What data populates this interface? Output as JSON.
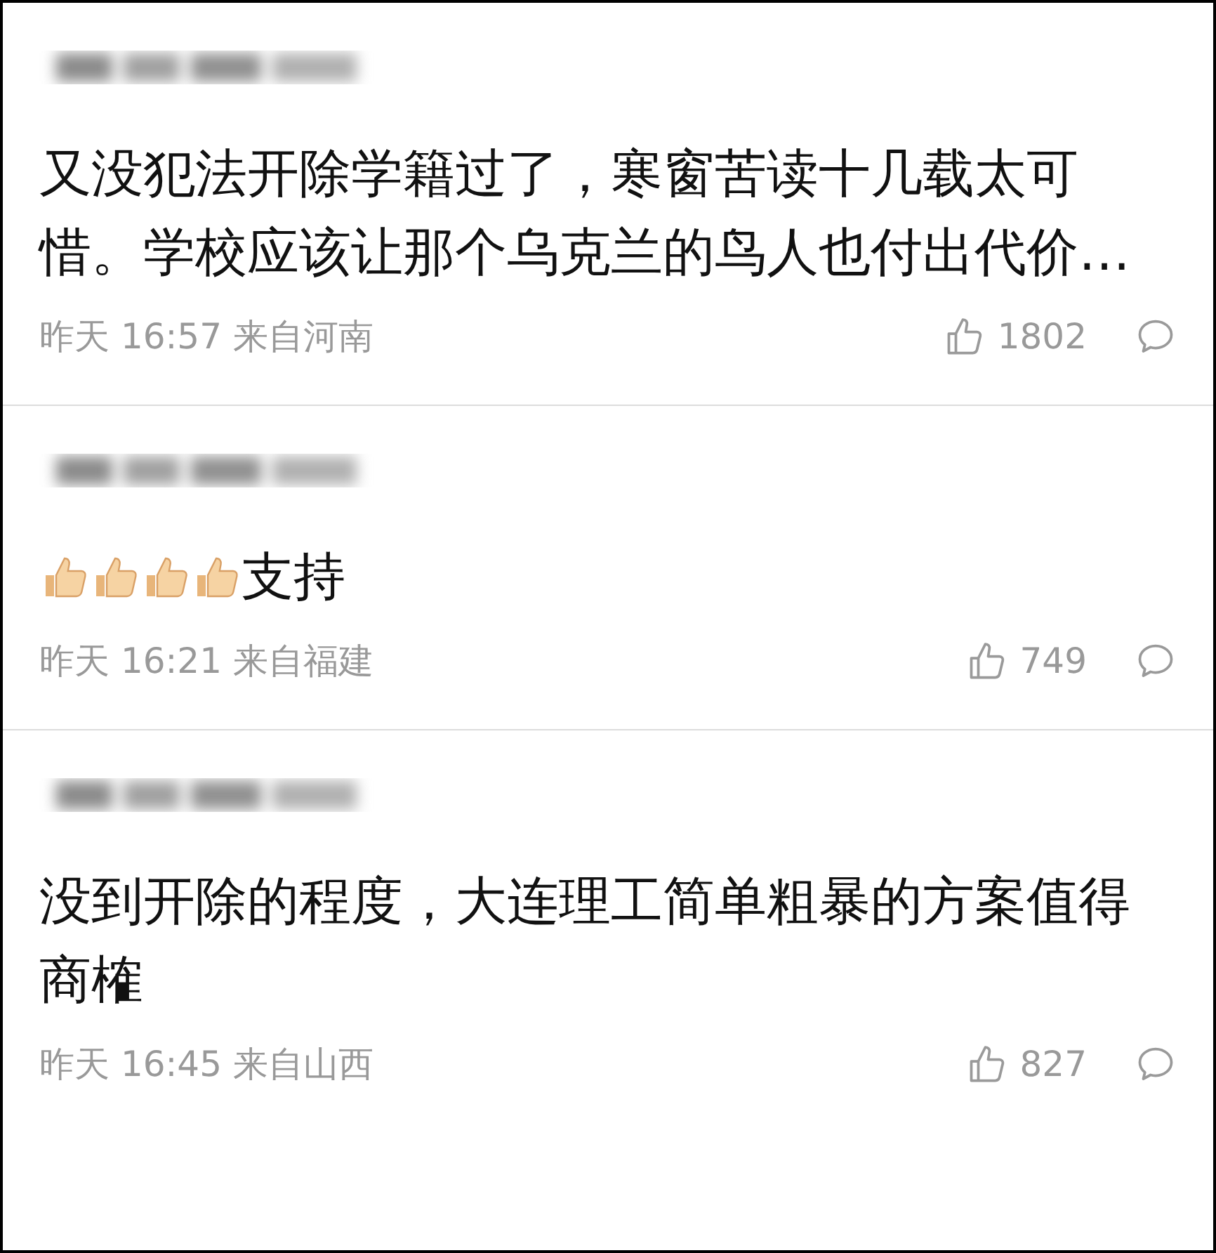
{
  "comments": [
    {
      "kind": "text",
      "text": "又没犯法开除学籍过了，寒窗苦读十几载太可惜。学校应该让那个乌克兰的鸟人也付出代价…",
      "time": "昨天 16:57",
      "source": "来自河南",
      "likes": "1802"
    },
    {
      "kind": "thumbs_text",
      "text": "支持",
      "time": "昨天 16:21",
      "source": "来自福建",
      "likes": "749"
    },
    {
      "kind": "text",
      "text": "没到开除的程度，大连理工简单粗暴的方案值得商榷",
      "time": "昨天 16:45",
      "source": "来自山西",
      "likes": "827"
    }
  ]
}
